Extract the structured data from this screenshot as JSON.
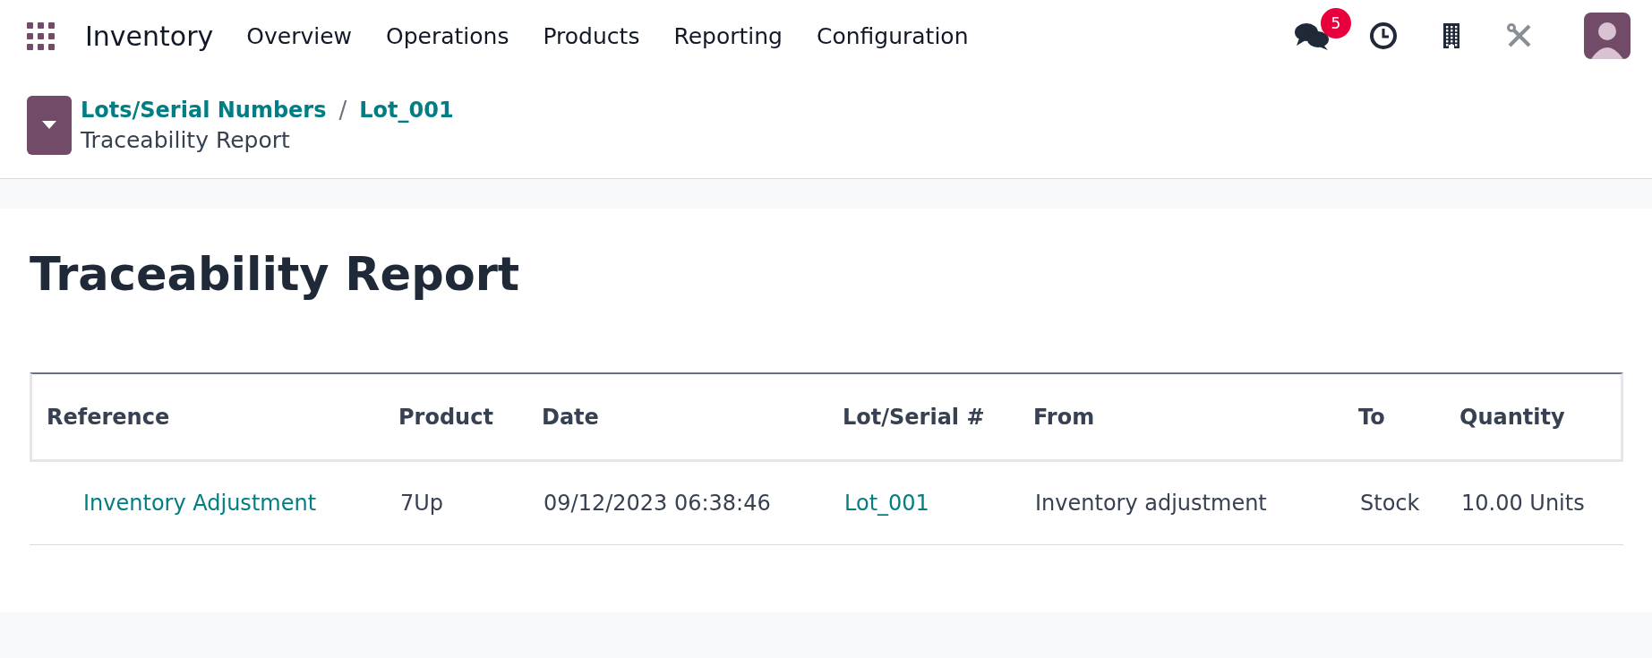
{
  "navbar": {
    "app_name": "Inventory",
    "menu": [
      "Overview",
      "Operations",
      "Products",
      "Reporting",
      "Configuration"
    ],
    "messages_badge": "5"
  },
  "breadcrumb": {
    "links": [
      "Lots/Serial Numbers",
      "Lot_001"
    ],
    "separator": "/",
    "current": "Traceability Report"
  },
  "report": {
    "title": "Traceability Report",
    "table": {
      "columns": [
        "Reference",
        "Product",
        "Date",
        "Lot/Serial #",
        "From",
        "To",
        "Quantity"
      ],
      "rows": [
        {
          "reference": "Inventory Adjustment",
          "product": "7Up",
          "date": "09/12/2023 06:38:46",
          "lot": "Lot_001",
          "from": "Inventory adjustment",
          "to": "Stock",
          "quantity": "10.00 Units"
        }
      ]
    }
  }
}
